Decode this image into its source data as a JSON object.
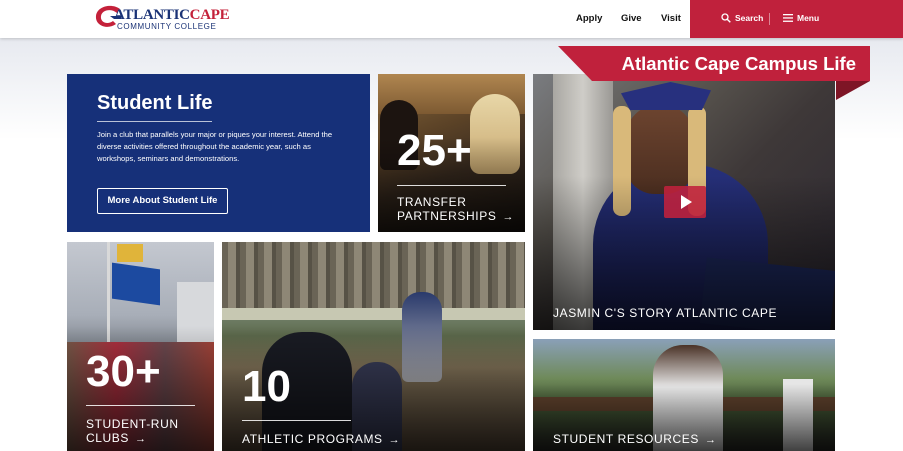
{
  "header": {
    "logo": {
      "word1": "ATLANTIC",
      "word2": "CAPE",
      "subline": "COMMUNITY COLLEGE"
    },
    "nav": [
      {
        "label": "Apply"
      },
      {
        "label": "Give"
      },
      {
        "label": "Visit"
      }
    ],
    "search_label": "Search",
    "menu_label": "Menu"
  },
  "banner": {
    "title": "Atlantic Cape Campus Life"
  },
  "student_life": {
    "title": "Student Life",
    "body": "Join a club that parallels your major or piques your interest. Attend the diverse activities offered throughout the academic year, such as workshops, seminars and demonstrations.",
    "button": "More About Student Life"
  },
  "tiles": {
    "transfer": {
      "number": "25+",
      "line1": "TRANSFER",
      "line2": "PARTNERSHIPS"
    },
    "video": {
      "label": "JASMIN C'S STORY ATLANTIC CAPE"
    },
    "clubs": {
      "number": "30+",
      "line1": "STUDENT-RUN",
      "line2": "CLUBS"
    },
    "athletics": {
      "number": "10",
      "line1": "ATHLETIC PROGRAMS"
    },
    "resources": {
      "line1": "STUDENT RESOURCES"
    }
  },
  "icons": {
    "search": "search-icon",
    "menu": "hamburger-icon",
    "play": "play-icon",
    "arrow": "arrow-right-icon"
  },
  "colors": {
    "brand_red": "#c0213c",
    "brand_blue": "#163079"
  }
}
